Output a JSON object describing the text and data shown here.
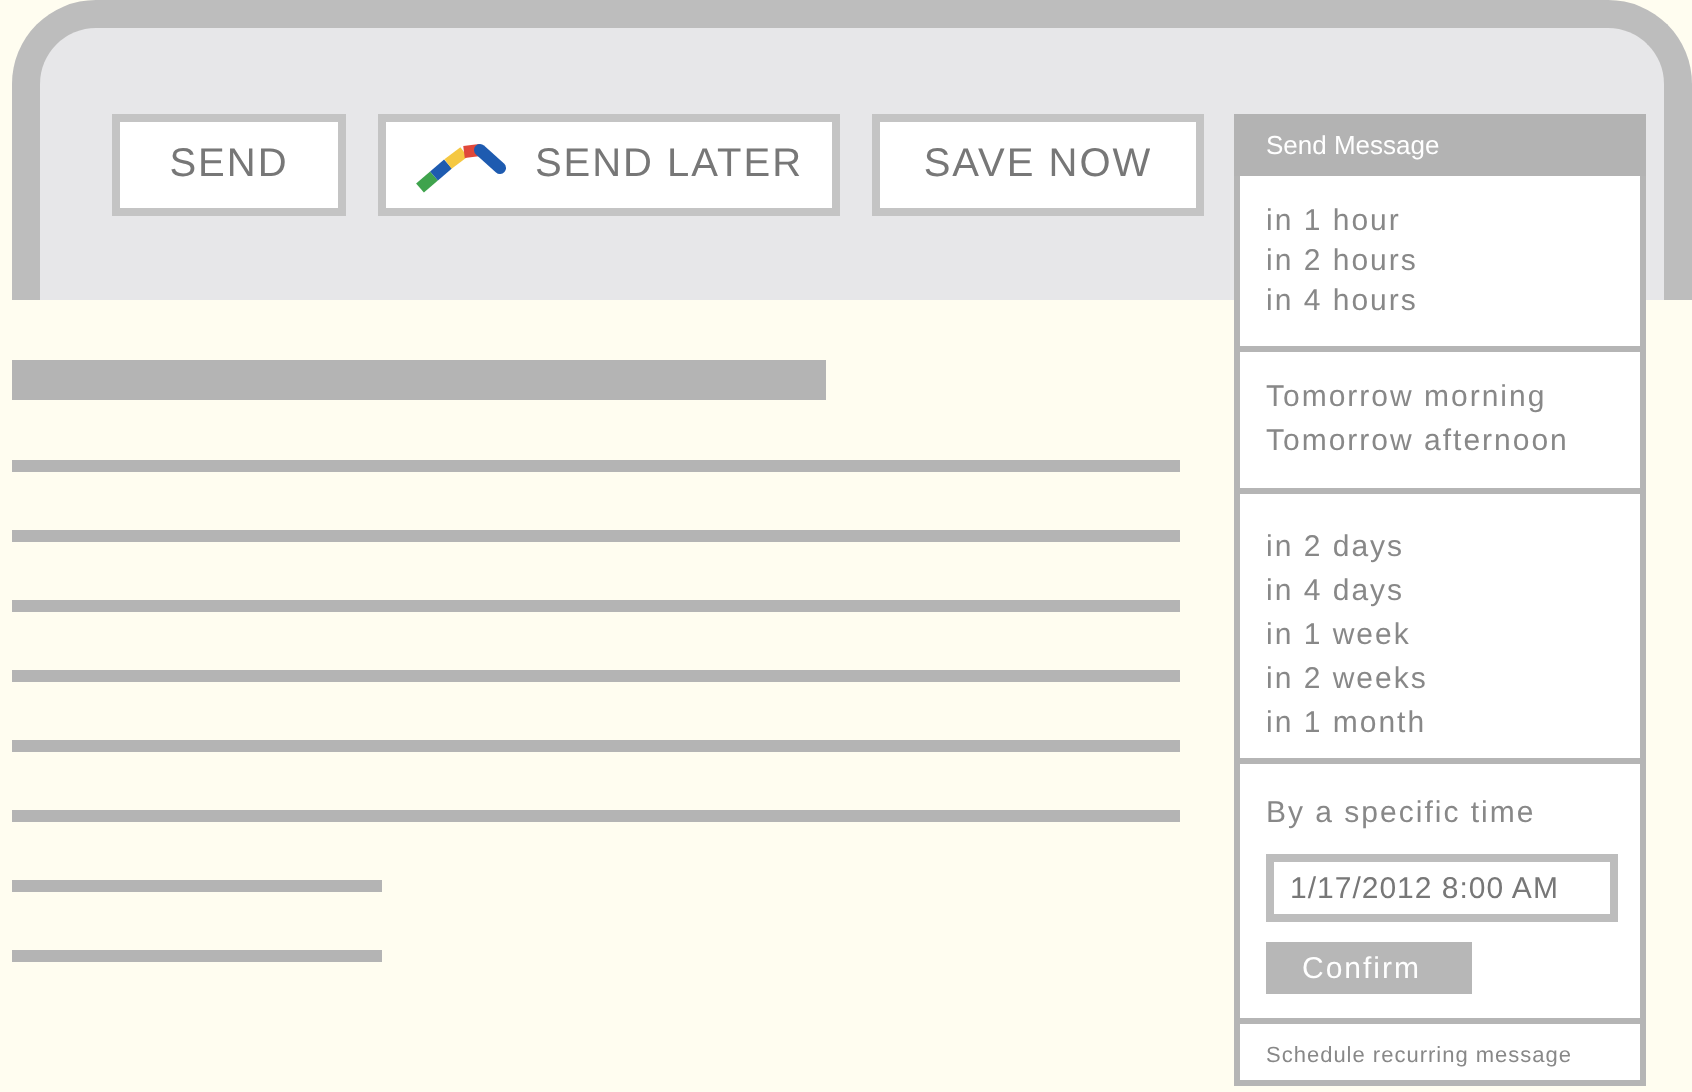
{
  "toolbar": {
    "buttons": [
      {
        "label": "SEND",
        "kind": "plain"
      },
      {
        "label": "SEND LATER",
        "kind": "logo"
      },
      {
        "label": "SAVE NOW",
        "kind": "plain"
      }
    ]
  },
  "send_menu": {
    "title": "Send Message",
    "sections": [
      {
        "kind": "options",
        "items": [
          "in 1 hour",
          "in 2 hours",
          "in 4 hours"
        ]
      },
      {
        "kind": "options",
        "items": [
          "Tomorrow morning",
          "Tomorrow afternoon"
        ]
      },
      {
        "kind": "options",
        "items": [
          "in 2 days",
          "in 4 days",
          "in 1 week",
          "in 2 weeks",
          "in 1 month"
        ]
      },
      {
        "kind": "specific_time",
        "label": "By a specific time",
        "value": "1/17/2012 8:00 AM",
        "button": "Confirm"
      },
      {
        "kind": "link",
        "label": "Schedule recurring message"
      }
    ]
  }
}
